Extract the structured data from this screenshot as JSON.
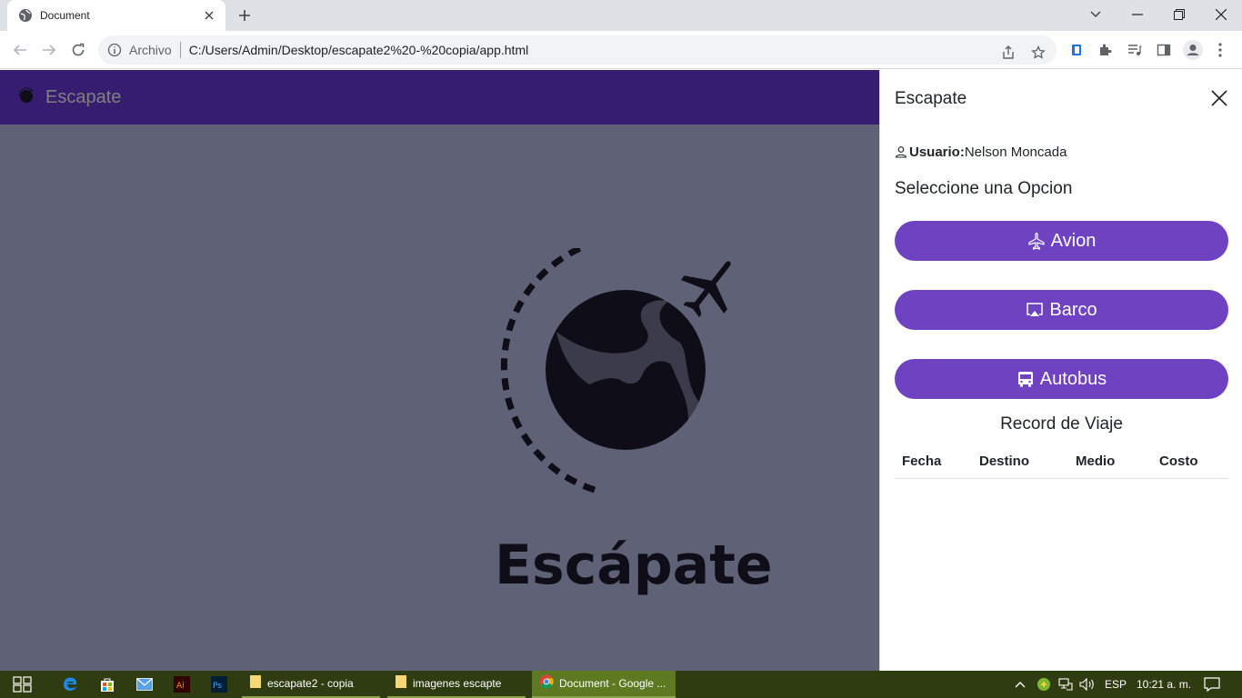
{
  "browser": {
    "tab_title": "Document",
    "scheme_label": "Archivo",
    "url": "C:/Users/Admin/Desktop/escapate2%20-%20copia/app.html"
  },
  "app": {
    "brand": "Escapate",
    "hero_word": "Escápate"
  },
  "offcanvas": {
    "title": "Escapate",
    "user_label": "Usuario:",
    "user_name": "Nelson Moncada",
    "heading": "Seleccione una Opcion",
    "options": [
      {
        "label": "Avion",
        "icon": "airplane-icon"
      },
      {
        "label": "Barco",
        "icon": "airplay-icon"
      },
      {
        "label": "Autobus",
        "icon": "bus-icon"
      }
    ],
    "record_title": "Record de Viaje",
    "table_headers": [
      "Fecha",
      "Destino",
      "Medio",
      "Costo"
    ]
  },
  "taskbar": {
    "apps": [
      "escapate2 - copia",
      "imagenes escapte",
      "Document - Google ..."
    ],
    "language": "ESP",
    "clock": "10:21 a. m."
  },
  "colors": {
    "brand": "#6f3ae0",
    "button": "#6f42c1",
    "taskbar": "#2f3c12"
  }
}
